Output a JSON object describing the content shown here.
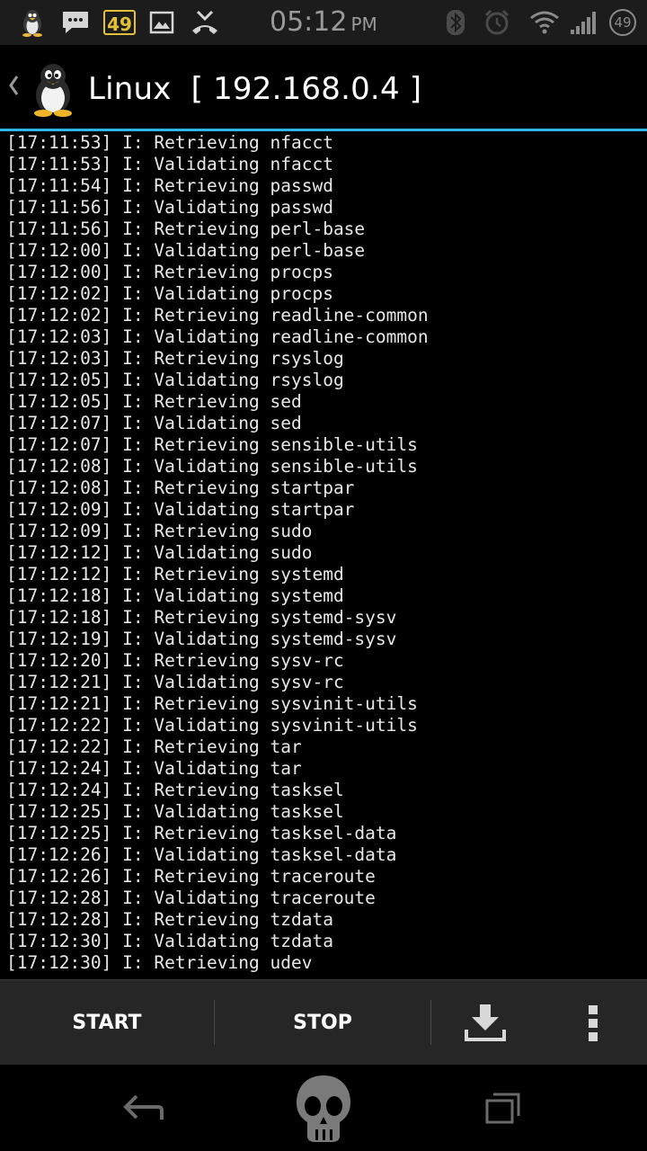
{
  "status_bar": {
    "notification_badge": "49",
    "time": "05:12",
    "ampm": "PM",
    "battery_level": "49",
    "icons": [
      "linux-penguin-icon",
      "message-icon",
      "notification-count-icon",
      "gallery-icon",
      "missed-call-icon",
      "bluetooth-icon",
      "alarm-icon",
      "wifi-icon",
      "signal-icon",
      "battery-icon"
    ]
  },
  "action_bar": {
    "title": "Linux  [ 192.168.0.4 ]",
    "icons": [
      "back-chevron-icon",
      "linux-penguin-icon"
    ]
  },
  "log": [
    "[17:11:53] I: Retrieving nfacct",
    "[17:11:53] I: Validating nfacct",
    "[17:11:54] I: Retrieving passwd",
    "[17:11:56] I: Validating passwd",
    "[17:11:56] I: Retrieving perl-base",
    "[17:12:00] I: Validating perl-base",
    "[17:12:00] I: Retrieving procps",
    "[17:12:02] I: Validating procps",
    "[17:12:02] I: Retrieving readline-common",
    "[17:12:03] I: Validating readline-common",
    "[17:12:03] I: Retrieving rsyslog",
    "[17:12:05] I: Validating rsyslog",
    "[17:12:05] I: Retrieving sed",
    "[17:12:07] I: Validating sed",
    "[17:12:07] I: Retrieving sensible-utils",
    "[17:12:08] I: Validating sensible-utils",
    "[17:12:08] I: Retrieving startpar",
    "[17:12:09] I: Validating startpar",
    "[17:12:09] I: Retrieving sudo",
    "[17:12:12] I: Validating sudo",
    "[17:12:12] I: Retrieving systemd",
    "[17:12:18] I: Validating systemd",
    "[17:12:18] I: Retrieving systemd-sysv",
    "[17:12:19] I: Validating systemd-sysv",
    "[17:12:20] I: Retrieving sysv-rc",
    "[17:12:21] I: Validating sysv-rc",
    "[17:12:21] I: Retrieving sysvinit-utils",
    "[17:12:22] I: Validating sysvinit-utils",
    "[17:12:22] I: Retrieving tar",
    "[17:12:24] I: Validating tar",
    "[17:12:24] I: Retrieving tasksel",
    "[17:12:25] I: Validating tasksel",
    "[17:12:25] I: Retrieving tasksel-data",
    "[17:12:26] I: Validating tasksel-data",
    "[17:12:26] I: Retrieving traceroute",
    "[17:12:28] I: Validating traceroute",
    "[17:12:28] I: Retrieving tzdata",
    "[17:12:30] I: Validating tzdata",
    "[17:12:30] I: Retrieving udev"
  ],
  "bottom_bar": {
    "start_label": "START",
    "stop_label": "STOP",
    "icons": [
      "download-icon",
      "overflow-menu-icon"
    ]
  },
  "nav_bar": {
    "icons": [
      "back-arrow-icon",
      "skull-home-icon",
      "recent-apps-icon"
    ]
  },
  "colors": {
    "accent": "#33b5e5",
    "status_bar_bg": "#1c1c1c",
    "bottom_bar_bg": "#262626",
    "log_text": "#e8e8e8",
    "badge_yellow": "#e3c03a"
  }
}
